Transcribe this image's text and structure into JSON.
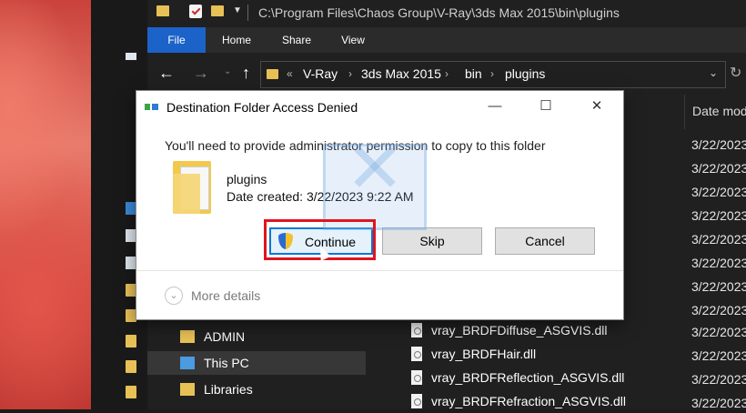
{
  "titlebar": {
    "path": "C:\\Program Files\\Chaos Group\\V-Ray\\3ds Max 2015\\bin\\plugins"
  },
  "ribbon": {
    "tabs": [
      "File",
      "Home",
      "Share",
      "View"
    ]
  },
  "address": {
    "crumbs": [
      "V-Ray",
      "3ds Max 2015",
      "bin",
      "plugins"
    ],
    "overflow": "«",
    "separator": "›"
  },
  "columns": {
    "date_modified": "Date mod"
  },
  "dates": [
    "3/22/2023",
    "3/22/2023",
    "3/22/2023",
    "3/22/2023",
    "3/22/2023",
    "3/22/2023",
    "3/22/2023",
    "3/22/2023",
    "3/22/2023",
    "3/22/2023",
    "3/22/2023",
    "3/22/2023"
  ],
  "nav_pane": [
    {
      "label": "ADMIN",
      "icon": "user-folder-icon"
    },
    {
      "label": "This PC",
      "icon": "computer-icon",
      "selected": true
    },
    {
      "label": "Libraries",
      "icon": "library-icon"
    }
  ],
  "files": [
    "vray_BRDFDiffuse_ASGVIS.dll",
    "vray_BRDFHair.dll",
    "vray_BRDFReflection_ASGVIS.dll",
    "vray_BRDFRefraction_ASGVIS.dll"
  ],
  "dialog": {
    "title": "Destination Folder Access Denied",
    "message": "You'll need to provide administrator permission to copy to this folder",
    "folder_name": "plugins",
    "date_created": "Date created: 3/22/2023 9:22 AM",
    "continue_label": "Continue",
    "skip_label": "Skip",
    "cancel_label": "Cancel",
    "more_details": "More details",
    "minimize": "—",
    "maximize": "☐",
    "close": "✕"
  },
  "colors": {
    "accent": "#0078d7",
    "highlight": "#e0141e",
    "ribbon_file": "#1c63c9",
    "folder": "#e8c156"
  }
}
